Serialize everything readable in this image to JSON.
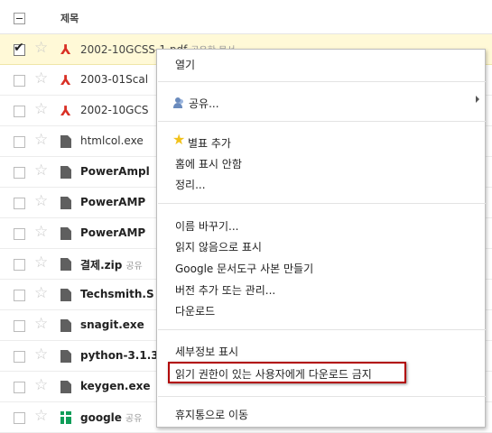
{
  "header": {
    "title": "제목"
  },
  "files": [
    {
      "name": "2002-10GCSS-1.pdf",
      "tag": "공유한 문서",
      "icon": "pdf-icon",
      "bold": false,
      "selected": true
    },
    {
      "name": "2003-01Scal",
      "tag": "",
      "icon": "pdf-icon",
      "bold": false,
      "selected": false
    },
    {
      "name": "2002-10GCS",
      "tag": "",
      "icon": "pdf-icon",
      "bold": false,
      "selected": false
    },
    {
      "name": "htmlcol.exe",
      "tag": "",
      "icon": "document-icon",
      "bold": false,
      "selected": false
    },
    {
      "name": "PowerAmpl",
      "tag": "",
      "icon": "document-icon",
      "bold": true,
      "selected": false
    },
    {
      "name": "PowerAMP",
      "tag": "",
      "icon": "document-icon",
      "bold": true,
      "selected": false
    },
    {
      "name": "PowerAMP",
      "tag": "",
      "icon": "document-icon",
      "bold": true,
      "selected": false
    },
    {
      "name": "결제.zip",
      "tag": "공유",
      "icon": "document-icon",
      "bold": true,
      "selected": false
    },
    {
      "name": "Techsmith.S",
      "tag": "",
      "icon": "document-icon",
      "bold": true,
      "selected": false
    },
    {
      "name": "snagit.exe",
      "tag": "",
      "icon": "document-icon",
      "bold": true,
      "selected": false
    },
    {
      "name": "python-3.1.3",
      "tag": "",
      "icon": "document-icon",
      "bold": true,
      "selected": false
    },
    {
      "name": "keygen.exe",
      "tag": "",
      "icon": "document-icon",
      "bold": true,
      "selected": false
    },
    {
      "name": "google",
      "tag": "공유",
      "icon": "spreadsheet-icon",
      "bold": true,
      "selected": false
    }
  ],
  "menu": {
    "open": "열기",
    "share": "공유...",
    "star": "별표 추가",
    "hide_home": "홈에 표시 안함",
    "organize": "정리...",
    "rename": "이름 바꾸기...",
    "mark_unread": "읽지 않음으로 표시",
    "make_copy": "Google 문서도구 사본 만들기",
    "versions": "버전 추가 또는 관리...",
    "download": "다운로드",
    "details": "세부정보 표시",
    "prevent_download": "읽기 권한이 있는 사용자에게 다운로드 금지",
    "trash": "휴지통으로 이동"
  },
  "colors": {
    "selected_row": "#fff9d7",
    "highlight_border": "#b10000",
    "star": "#f2c21b",
    "pdf": "#d93025",
    "sheet": "#0f9d58"
  }
}
